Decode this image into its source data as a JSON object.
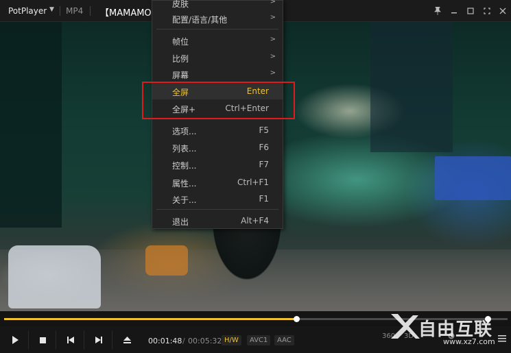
{
  "titlebar": {
    "app_name": "PotPlayer",
    "format": "MP4",
    "file_title": "【MAMAMO"
  },
  "menu": {
    "items": [
      {
        "label": "皮肤",
        "shortcut": "",
        "submenu": true
      },
      {
        "label": "配置/语言/其他",
        "shortcut": "",
        "submenu": true
      },
      {
        "label": "帧位",
        "shortcut": "",
        "submenu": true
      },
      {
        "label": "比例",
        "shortcut": "",
        "submenu": true
      },
      {
        "label": "屏幕",
        "shortcut": "",
        "submenu": true
      },
      {
        "label": "全屏",
        "shortcut": "Enter",
        "submenu": false,
        "active": true
      },
      {
        "label": "全屏+",
        "shortcut": "Ctrl+Enter",
        "submenu": false
      },
      {
        "label": "选项...",
        "shortcut": "F5",
        "submenu": false
      },
      {
        "label": "列表...",
        "shortcut": "F6",
        "submenu": false
      },
      {
        "label": "控制...",
        "shortcut": "F7",
        "submenu": false
      },
      {
        "label": "属性...",
        "shortcut": "Ctrl+F1",
        "submenu": false
      },
      {
        "label": "关于...",
        "shortcut": "F1",
        "submenu": false
      },
      {
        "label": "退出",
        "shortcut": "Alt+F4",
        "submenu": false
      }
    ],
    "submenu_arrow": ">"
  },
  "playback": {
    "current_time": "00:01:48",
    "separator": "/",
    "duration": "00:05:32",
    "progress_fraction": 0.58,
    "volume_fraction": 0.96
  },
  "badges": {
    "hw": "H/W",
    "video_codec": "AVC1",
    "audio_codec": "AAC"
  },
  "right_controls": {
    "label_360": "360",
    "label_3d": "3D"
  },
  "watermark": {
    "brand": "自由互联",
    "url": "www.xz7.com"
  },
  "colors": {
    "accent": "#f0c232",
    "highlight_box": "#e11b1b"
  },
  "icons": {
    "pin": "pin-icon",
    "minimize": "minimize-icon",
    "maximize": "maximize-icon",
    "fullscreen": "fullscreen-icon",
    "close": "close-icon",
    "play": "play-icon",
    "stop": "stop-icon",
    "prev": "previous-icon",
    "next": "next-icon",
    "eject": "eject-icon",
    "menu": "hamburger-menu-icon",
    "gear": "gear-icon"
  }
}
